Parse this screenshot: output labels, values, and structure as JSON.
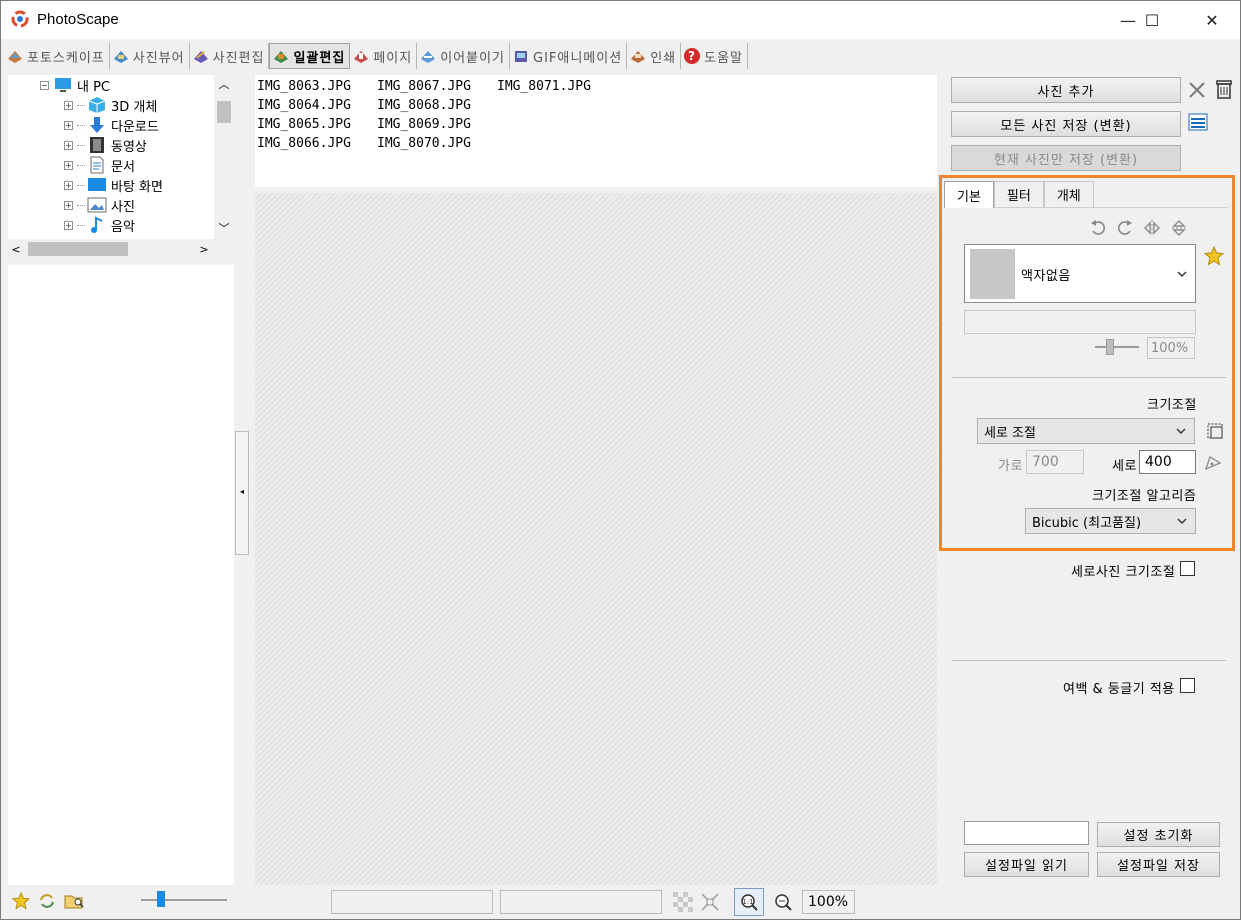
{
  "window": {
    "title": "PhotoScape",
    "minimize_label": "—",
    "maximize_label": "☐",
    "close_label": "✕"
  },
  "tabs": [
    {
      "label": "포토스케이프",
      "icon": "photoscape-icon",
      "active": false
    },
    {
      "label": "사진뷰어",
      "icon": "viewer-icon",
      "active": false
    },
    {
      "label": "사진편집",
      "icon": "editor-icon",
      "active": false
    },
    {
      "label": "일괄편집",
      "icon": "batch-icon",
      "active": true
    },
    {
      "label": "페이지",
      "icon": "page-icon",
      "active": false
    },
    {
      "label": "이어붙이기",
      "icon": "combine-icon",
      "active": false
    },
    {
      "label": "GIF애니메이션",
      "icon": "gif-icon",
      "active": false
    },
    {
      "label": "인쇄",
      "icon": "print-icon",
      "active": false
    },
    {
      "label": "도움말",
      "icon": "help-icon",
      "active": false
    }
  ],
  "tree": {
    "root": {
      "label": "내 PC",
      "icon": "pc-icon"
    },
    "items": [
      {
        "label": "3D 개체",
        "icon": "cube-icon"
      },
      {
        "label": "다운로드",
        "icon": "download-icon"
      },
      {
        "label": "동영상",
        "icon": "video-icon"
      },
      {
        "label": "문서",
        "icon": "document-icon"
      },
      {
        "label": "바탕 화면",
        "icon": "desktop-icon"
      },
      {
        "label": "사진",
        "icon": "picture-icon"
      },
      {
        "label": "음악",
        "icon": "music-icon"
      }
    ]
  },
  "files": {
    "columns": [
      [
        "IMG_8063.JPG",
        "IMG_8064.JPG",
        "IMG_8065.JPG",
        "IMG_8066.JPG"
      ],
      [
        "IMG_8067.JPG",
        "IMG_8068.JPG",
        "IMG_8069.JPG",
        "IMG_8070.JPG"
      ],
      [
        "IMG_8071.JPG"
      ]
    ]
  },
  "right": {
    "add_photo": "사진 추가",
    "save_all": "모든 사진 저장 (변환)",
    "save_current": "현재 사진만 저장 (변환)",
    "subtabs": [
      "기본",
      "필터",
      "개체"
    ],
    "frame_value": "액자없음",
    "opacity": "100%",
    "resize_title": "크기조절",
    "resize_mode": "세로 조절",
    "width_label": "가로",
    "width_value": "700",
    "height_label": "세로",
    "height_value": "400",
    "algo_label": "크기조절 알고리즘",
    "algo_value": "Bicubic (최고품질)",
    "portrait_resize": "세로사진 크기조절",
    "margin_round": "여백 & 둥글기 적용",
    "reset_settings": "설정 초기화",
    "load_settings": "설정파일 읽기",
    "save_settings": "설정파일 저장"
  },
  "status": {
    "zoom": "100%"
  },
  "colors": {
    "highlight": "#f0852a",
    "accent_blue": "#1a8be0"
  }
}
